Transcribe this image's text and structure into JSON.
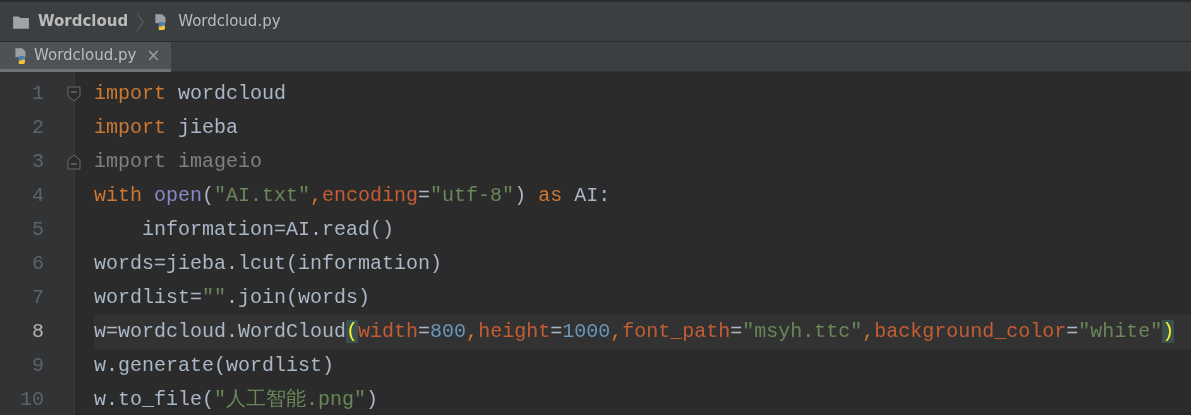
{
  "breadcrumb": [
    {
      "kind": "folder",
      "label": "Wordcloud"
    },
    {
      "kind": "python",
      "label": "Wordcloud.py"
    }
  ],
  "tabs": [
    {
      "label": "Wordcloud.py",
      "close": "×",
      "selected": true
    }
  ],
  "editor": {
    "lines": [
      {
        "number": "1",
        "current": false,
        "fold_open": true,
        "fold_close": false,
        "tokens": [
          {
            "text": "import",
            "kind": "kw"
          },
          {
            "text": " wordcloud",
            "kind": "plain"
          }
        ]
      },
      {
        "number": "2",
        "current": false,
        "fold_open": false,
        "fold_close": false,
        "tokens": [
          {
            "text": "import",
            "kind": "kw"
          },
          {
            "text": " jieba",
            "kind": "plain"
          }
        ]
      },
      {
        "number": "3",
        "current": false,
        "fold_open": false,
        "fold_close": true,
        "tokens": [
          {
            "text": "import imageio",
            "kind": "unused"
          }
        ]
      },
      {
        "number": "4",
        "current": false,
        "fold_open": false,
        "fold_close": false,
        "tokens": [
          {
            "text": "with ",
            "kind": "kw"
          },
          {
            "text": "open",
            "kind": "builtin"
          },
          {
            "text": "(",
            "kind": "plain"
          },
          {
            "text": "\"AI.txt\"",
            "kind": "str"
          },
          {
            "text": ",",
            "kind": "kw"
          },
          {
            "text": "encoding",
            "kind": "param"
          },
          {
            "text": "=",
            "kind": "plain"
          },
          {
            "text": "\"utf-8\"",
            "kind": "str"
          },
          {
            "text": ") ",
            "kind": "plain"
          },
          {
            "text": "as",
            "kind": "kw"
          },
          {
            "text": " AI:",
            "kind": "plain"
          }
        ]
      },
      {
        "number": "5",
        "current": false,
        "fold_open": false,
        "fold_close": false,
        "tokens": [
          {
            "text": "    information=AI.read()",
            "kind": "plain"
          }
        ]
      },
      {
        "number": "6",
        "current": false,
        "fold_open": false,
        "fold_close": false,
        "tokens": [
          {
            "text": "words=jieba.lcut(information)",
            "kind": "plain"
          }
        ]
      },
      {
        "number": "7",
        "current": false,
        "fold_open": false,
        "fold_close": false,
        "tokens": [
          {
            "text": "wordlist=",
            "kind": "plain"
          },
          {
            "text": "\"\"",
            "kind": "str"
          },
          {
            "text": ".join(words)",
            "kind": "plain"
          }
        ]
      },
      {
        "number": "8",
        "current": true,
        "fold_open": false,
        "fold_close": false,
        "tokens": [
          {
            "text": "w=wordcloud.WordCloud",
            "kind": "plain"
          },
          {
            "text": "(",
            "kind": "match"
          },
          {
            "text": "width",
            "kind": "param"
          },
          {
            "text": "=",
            "kind": "plain"
          },
          {
            "text": "800",
            "kind": "num"
          },
          {
            "text": ",",
            "kind": "kw"
          },
          {
            "text": "height",
            "kind": "param"
          },
          {
            "text": "=",
            "kind": "plain"
          },
          {
            "text": "1000",
            "kind": "num"
          },
          {
            "text": ",",
            "kind": "kw"
          },
          {
            "text": "font_path",
            "kind": "param"
          },
          {
            "text": "=",
            "kind": "plain"
          },
          {
            "text": "\"msyh.ttc\"",
            "kind": "str"
          },
          {
            "text": ",",
            "kind": "kw"
          },
          {
            "text": "background_color",
            "kind": "param"
          },
          {
            "text": "=",
            "kind": "plain"
          },
          {
            "text": "\"white\"",
            "kind": "str"
          },
          {
            "text": ")",
            "kind": "match"
          }
        ]
      },
      {
        "number": "9",
        "current": false,
        "fold_open": false,
        "fold_close": false,
        "tokens": [
          {
            "text": "w.generate(wordlist)",
            "kind": "plain"
          }
        ]
      },
      {
        "number": "10",
        "current": false,
        "fold_open": false,
        "fold_close": false,
        "tokens": [
          {
            "text": "w.to_file(",
            "kind": "plain"
          },
          {
            "text": "\"人工智能.png\"",
            "kind": "str"
          },
          {
            "text": ")",
            "kind": "plain"
          }
        ]
      }
    ]
  }
}
